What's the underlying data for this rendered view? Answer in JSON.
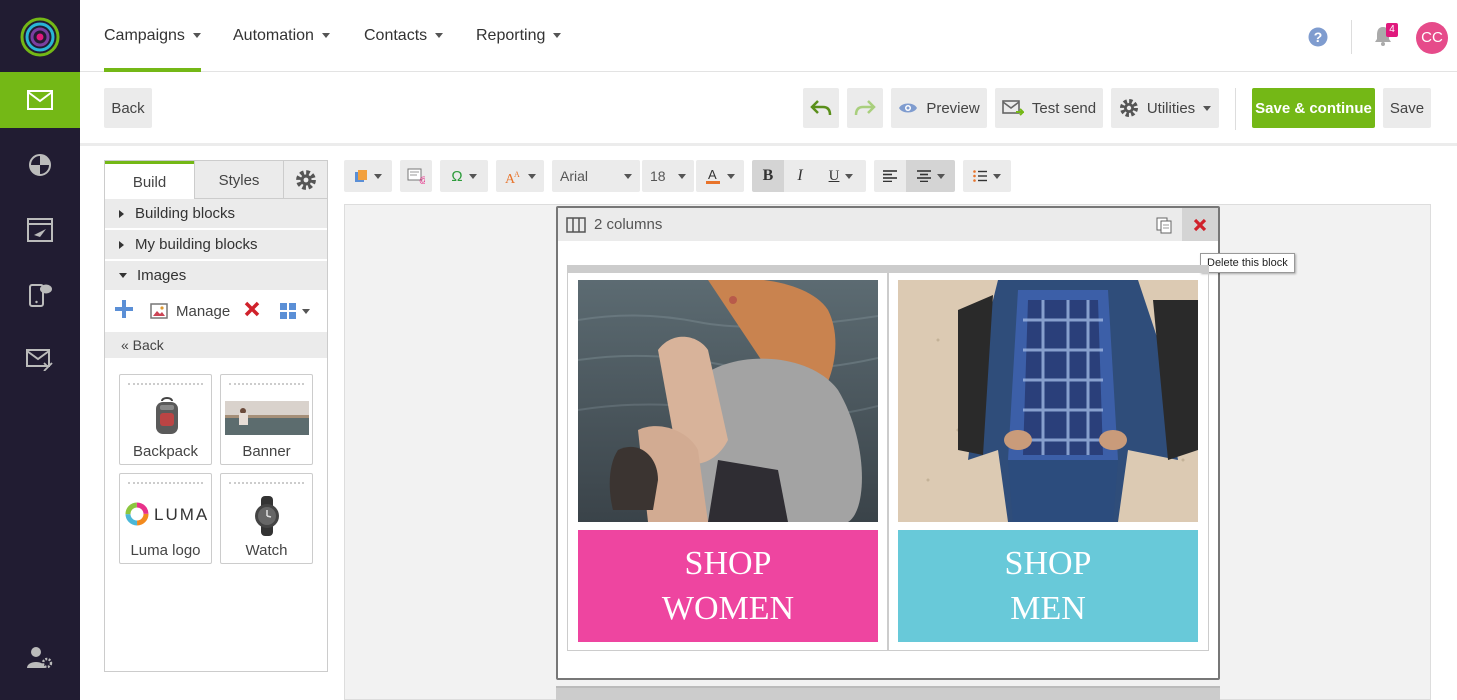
{
  "nav": {
    "menus": [
      {
        "label": "Campaigns"
      },
      {
        "label": "Automation"
      },
      {
        "label": "Contacts"
      },
      {
        "label": "Reporting"
      }
    ],
    "notifications_count": "4",
    "avatar_initials": "CC"
  },
  "toolbar": {
    "back_label": "Back",
    "preview_label": "Preview",
    "test_send_label": "Test send",
    "utilities_label": "Utilities",
    "save_continue_label": "Save & continue",
    "save_label": "Save"
  },
  "panel": {
    "tabs": {
      "build": "Build",
      "styles": "Styles"
    },
    "sections": {
      "building_blocks": "Building blocks",
      "my_building_blocks": "My building blocks",
      "images": "Images"
    },
    "manage_label": "Manage",
    "back_link": "« Back",
    "tiles": [
      {
        "label": "Backpack"
      },
      {
        "label": "Banner"
      },
      {
        "label": "Luma logo",
        "logo_text": "LUMA"
      },
      {
        "label": "Watch"
      }
    ]
  },
  "editor": {
    "font_family": "Arial",
    "font_size": "18",
    "block_title": "2 columns",
    "delete_tooltip": "Delete this block",
    "columns": [
      {
        "cta_line1": "SHOP",
        "cta_line2": "WOMEN",
        "cta_color": "#ee45a0"
      },
      {
        "cta_line1": "SHOP",
        "cta_line2": "MEN",
        "cta_color": "#68c9d9"
      }
    ]
  },
  "colors": {
    "accent": "#74b816",
    "rail": "#211c32",
    "badge": "#e0197d",
    "avatar": "#e64b8a"
  }
}
